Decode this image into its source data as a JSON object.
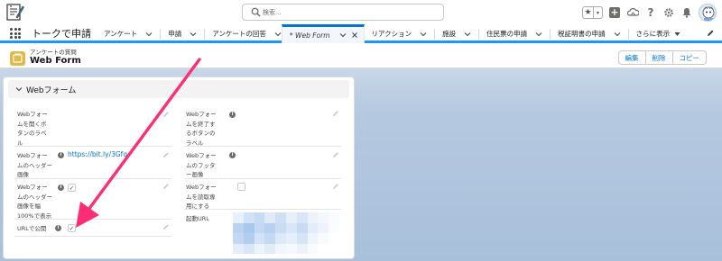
{
  "app": {
    "name": "トークで申請"
  },
  "search": {
    "placeholder": "検索..."
  },
  "nav": {
    "items": [
      {
        "label": "アンケート"
      },
      {
        "label": "申請"
      },
      {
        "label": "アンケートの回答"
      },
      {
        "label": "* Web Form"
      },
      {
        "label": "リアクション"
      },
      {
        "label": "施設"
      },
      {
        "label": "住民票の申請"
      },
      {
        "label": "税証明書の申請"
      }
    ],
    "more_label": "さらに表示"
  },
  "record": {
    "type_label": "アンケートの質問",
    "title": "Web Form",
    "buttons": {
      "edit": "編集",
      "delete": "削除",
      "copy": "コピー"
    }
  },
  "section": {
    "title": "Webフォーム"
  },
  "fields": {
    "open_button_label": {
      "label_lines": [
        "Webフォー",
        "ムを開くボ",
        "タンのラベ",
        "ル"
      ]
    },
    "close_button_label": {
      "label_lines": [
        "Webフォー",
        "ムを終了す",
        "るボタンの",
        "ラベル"
      ]
    },
    "header_image": {
      "label_lines": [
        "Webフォー",
        "ムのヘッダー",
        "画像"
      ],
      "value": "https://bit.ly/3Gfq"
    },
    "footer_image": {
      "label_lines": [
        "Webフォー",
        "ムのフッタ",
        "ー画像"
      ]
    },
    "header_full_width": {
      "label_lines": [
        "Webフォー",
        "ムのヘッダー",
        "画像を幅",
        "100%で表示"
      ],
      "checked": true
    },
    "read_only": {
      "label_lines": [
        "Webフォー",
        "ムを読取専",
        "用にする"
      ],
      "checked": false
    },
    "public_url": {
      "label_lines": [
        "URLで公開"
      ],
      "checked": true
    },
    "start_url": {
      "label_lines": [
        "起動URL"
      ]
    }
  },
  "colors": {
    "brand": "#0176d3",
    "active_tab_border": "#1b96ff",
    "record_icon": "#e3b945",
    "arrow": "#ff2d73"
  }
}
